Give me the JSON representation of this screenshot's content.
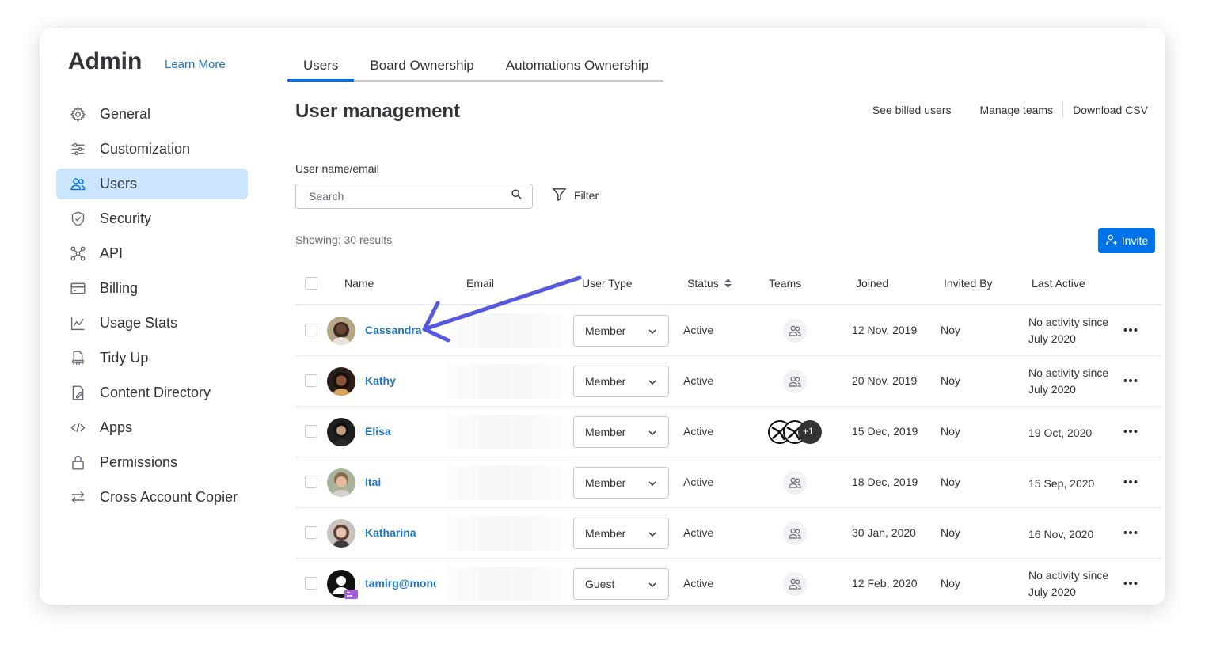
{
  "sidebar": {
    "title": "Admin",
    "learn_more": "Learn More",
    "items": [
      {
        "label": "General",
        "icon": "gear-icon"
      },
      {
        "label": "Customization",
        "icon": "sliders-icon"
      },
      {
        "label": "Users",
        "icon": "users-icon",
        "active": true
      },
      {
        "label": "Security",
        "icon": "shield-icon"
      },
      {
        "label": "API",
        "icon": "api-icon"
      },
      {
        "label": "Billing",
        "icon": "credit-card-icon"
      },
      {
        "label": "Usage Stats",
        "icon": "chart-icon"
      },
      {
        "label": "Tidy Up",
        "icon": "broom-icon"
      },
      {
        "label": "Content Directory",
        "icon": "document-icon"
      },
      {
        "label": "Apps",
        "icon": "code-icon"
      },
      {
        "label": "Permissions",
        "icon": "lock-icon"
      },
      {
        "label": "Cross Account Copier",
        "icon": "swap-arrows-icon"
      }
    ]
  },
  "tabs": [
    {
      "label": "Users",
      "active": true
    },
    {
      "label": "Board Ownership"
    },
    {
      "label": "Automations Ownership"
    }
  ],
  "header": {
    "title": "User management",
    "links": [
      "See billed users",
      "Manage teams",
      "Download CSV"
    ]
  },
  "search": {
    "label": "User name/email",
    "placeholder": "Search"
  },
  "filter_label": "Filter",
  "showing": "Showing: 30 results",
  "invite_label": "Invite",
  "table": {
    "columns": [
      "Name",
      "Email",
      "User Type",
      "Status",
      "Teams",
      "Joined",
      "Invited By",
      "Last Active"
    ],
    "rows": [
      {
        "name": "Cassandra",
        "user_type": "Member",
        "status": "Active",
        "teams": "none",
        "joined": "12 Nov, 2019",
        "invited_by": "Noy",
        "last_active_1": "No activity since",
        "last_active_2": "July 2020"
      },
      {
        "name": "Kathy",
        "user_type": "Member",
        "status": "Active",
        "teams": "none",
        "joined": "20 Nov, 2019",
        "invited_by": "Noy",
        "last_active_1": "No activity since",
        "last_active_2": "July 2020"
      },
      {
        "name": "Elisa",
        "user_type": "Member",
        "status": "Active",
        "teams": "+1",
        "joined": "15 Dec, 2019",
        "invited_by": "Noy",
        "last_active_1": "19 Oct, 2020",
        "last_active_2": ""
      },
      {
        "name": "Itai",
        "user_type": "Member",
        "status": "Active",
        "teams": "none",
        "joined": "18 Dec, 2019",
        "invited_by": "Noy",
        "last_active_1": "15 Sep, 2020",
        "last_active_2": ""
      },
      {
        "name": "Katharina",
        "user_type": "Member",
        "status": "Active",
        "teams": "none",
        "joined": "30 Jan, 2020",
        "invited_by": "Noy",
        "last_active_1": "16 Nov, 2020",
        "last_active_2": ""
      },
      {
        "name": "tamirg@mond",
        "user_type": "Guest",
        "status": "Active",
        "teams": "none",
        "joined": "12 Feb, 2020",
        "invited_by": "Noy",
        "last_active_1": "No activity since",
        "last_active_2": "July 2020"
      }
    ]
  },
  "colors": {
    "accent": "#0073ea",
    "link": "#1f76c2",
    "active_nav_bg": "#cce5ff",
    "annotation_arrow": "#5559df"
  }
}
